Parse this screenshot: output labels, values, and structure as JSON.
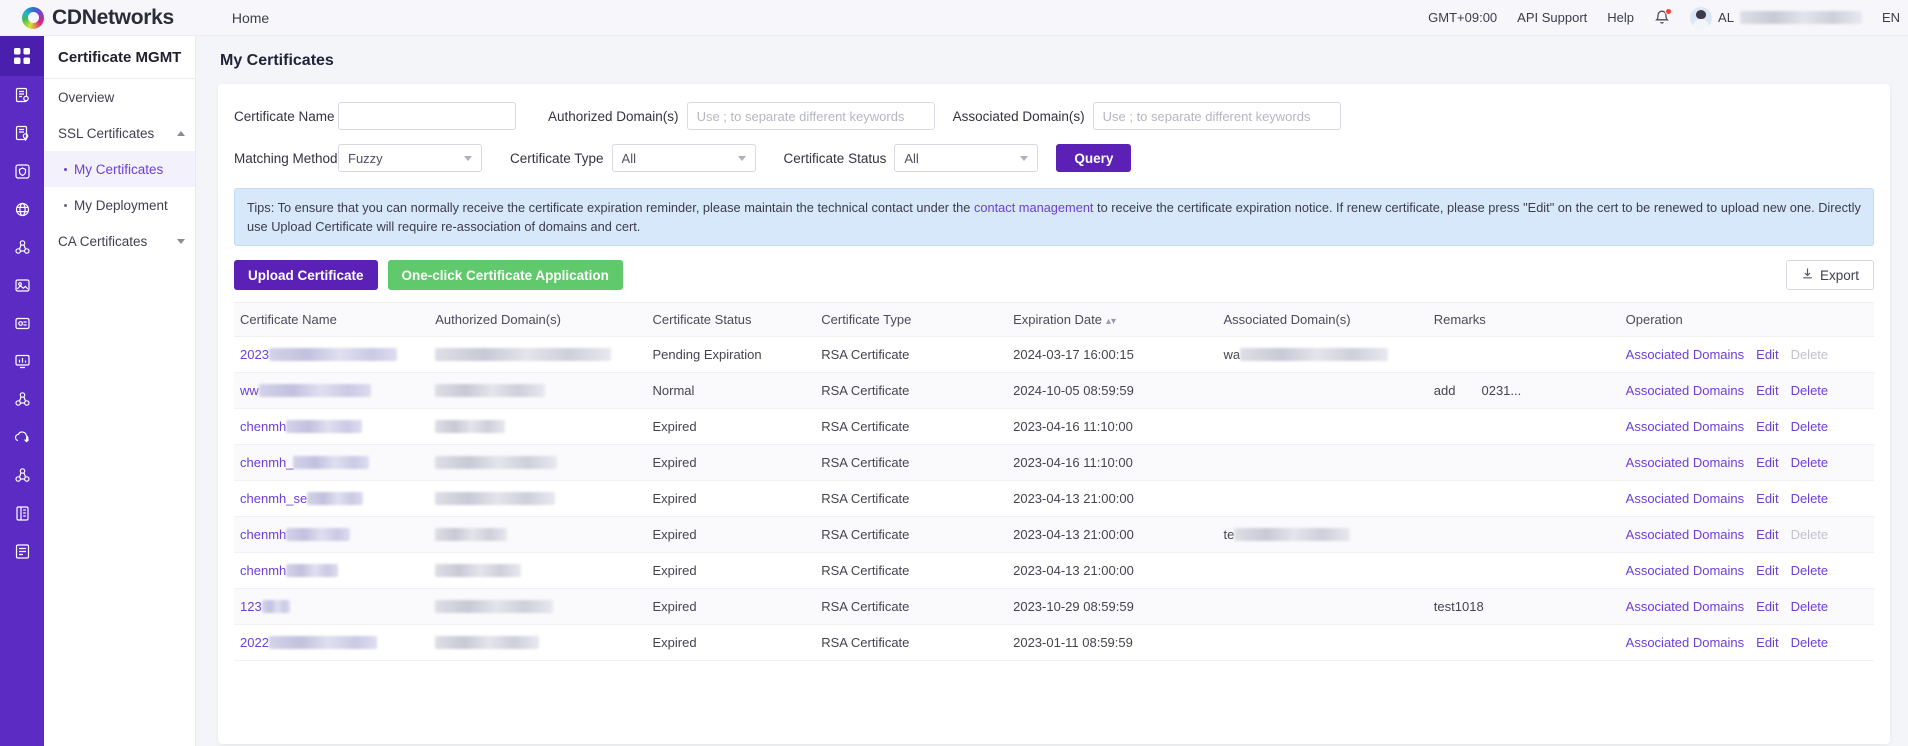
{
  "header": {
    "brand": "CDNetworks",
    "nav_home": "Home",
    "timezone": "GMT+09:00",
    "api_support": "API Support",
    "help": "Help",
    "user_prefix": "AL",
    "language": "EN",
    "bell_icon": "bell-icon",
    "avatar_icon": "avatar-icon"
  },
  "rail": {
    "items": [
      {
        "icon": "grid-apps-icon"
      },
      {
        "icon": "document-eye-icon"
      },
      {
        "icon": "certificate-icon"
      },
      {
        "icon": "shield-security-icon"
      },
      {
        "icon": "globe-cdn-icon"
      },
      {
        "icon": "nodes-network-icon"
      },
      {
        "icon": "image-media-icon"
      },
      {
        "icon": "media-card-icon"
      },
      {
        "icon": "monitor-chart-icon"
      },
      {
        "icon": "nodes-cluster-icon"
      },
      {
        "icon": "cloud-upload-icon"
      },
      {
        "icon": "nodes-cluster-2-icon"
      },
      {
        "icon": "server-rack-icon"
      },
      {
        "icon": "storage-db-icon"
      }
    ]
  },
  "sidebar": {
    "title": "Certificate MGMT",
    "items": [
      {
        "label": "Overview",
        "type": "link"
      },
      {
        "label": "SSL Certificates",
        "type": "group",
        "expanded": true,
        "caret": "chevron-up-icon"
      },
      {
        "label": "My Certificates",
        "type": "sub",
        "active": true
      },
      {
        "label": "My Deployment",
        "type": "sub",
        "active": false
      },
      {
        "label": "CA Certificates",
        "type": "group",
        "expanded": false,
        "caret": "chevron-down-icon"
      }
    ]
  },
  "page": {
    "title": "My Certificates"
  },
  "filters": {
    "certificate_name_label": "Certificate Name",
    "certificate_name_value": "",
    "certificate_name_placeholder": "",
    "authorized_domains_label": "Authorized Domain(s)",
    "authorized_domains_value": "",
    "authorized_domains_placeholder": "Use ; to separate different keywords",
    "associated_domains_label": "Associated Domain(s)",
    "associated_domains_value": "",
    "associated_domains_placeholder": "Use ; to separate different keywords",
    "matching_method_label": "Matching Method",
    "matching_method_value": "Fuzzy",
    "certificate_type_label": "Certificate Type",
    "certificate_type_value": "All",
    "certificate_status_label": "Certificate Status",
    "certificate_status_value": "All",
    "query_button": "Query"
  },
  "tips": {
    "part1": "Tips: To ensure that you can normally receive the certificate expiration reminder, please maintain the technical contact under the ",
    "link": "contact management",
    "part2": " to receive the certificate expiration notice. If renew certificate, please press \"Edit\" on the cert to be renewed to upload new one. Directly use Upload Certificate will require re-association of domains and cert."
  },
  "toolbar": {
    "upload_label": "Upload Certificate",
    "oneclick_label": "One-click Certificate Application",
    "export_label": "Export",
    "export_icon": "download-icon"
  },
  "table": {
    "columns": [
      "Certificate Name",
      "Authorized Domain(s)",
      "Certificate Status",
      "Certificate Type",
      "Expiration Date",
      "Associated Domain(s)",
      "Remarks",
      "Operation"
    ],
    "sort_column": "Expiration Date",
    "sort_icon": "sort-updown-icon",
    "operations": {
      "associated_domains": "Associated Domains",
      "edit": "Edit",
      "delete": "Delete"
    },
    "rows": [
      {
        "name_prefix": "2023",
        "name_redact_w": 128,
        "auth_redact_w": 176,
        "status": "Pending Expiration",
        "status_kind": "pending",
        "type": "RSA Certificate",
        "expiration": "2024-03-17 16:00:15",
        "assoc_prefix": "wa",
        "assoc_redact_w": 148,
        "remark": "",
        "remark_redact_w": 0,
        "delete_enabled": false
      },
      {
        "name_prefix": "ww",
        "name_redact_w": 112,
        "auth_redact_w": 110,
        "status": "Normal",
        "status_kind": "normal",
        "type": "RSA Certificate",
        "expiration": "2024-10-05 08:59:59",
        "assoc_prefix": "",
        "assoc_redact_w": 0,
        "remark": "add  0231...",
        "remark_redact_w": 0,
        "delete_enabled": true
      },
      {
        "name_prefix": "chenmh",
        "name_redact_w": 76,
        "auth_redact_w": 70,
        "status": "Expired",
        "status_kind": "expired",
        "type": "RSA Certificate",
        "expiration": "2023-04-16 11:10:00",
        "assoc_prefix": "",
        "assoc_redact_w": 0,
        "remark": "",
        "remark_redact_w": 0,
        "delete_enabled": true
      },
      {
        "name_prefix": "chenmh_",
        "name_redact_w": 76,
        "auth_redact_w": 122,
        "status": "Expired",
        "status_kind": "expired",
        "type": "RSA Certificate",
        "expiration": "2023-04-16 11:10:00",
        "assoc_prefix": "",
        "assoc_redact_w": 0,
        "remark": "",
        "remark_redact_w": 0,
        "delete_enabled": true
      },
      {
        "name_prefix": "chenmh_se",
        "name_redact_w": 56,
        "auth_redact_w": 120,
        "status": "Expired",
        "status_kind": "expired",
        "type": "RSA Certificate",
        "expiration": "2023-04-13 21:00:00",
        "assoc_prefix": "",
        "assoc_redact_w": 0,
        "remark": "",
        "remark_redact_w": 0,
        "delete_enabled": true
      },
      {
        "name_prefix": "chenmh",
        "name_redact_w": 64,
        "auth_redact_w": 72,
        "status": "Expired",
        "status_kind": "expired",
        "type": "RSA Certificate",
        "expiration": "2023-04-13 21:00:00",
        "assoc_prefix": "te",
        "assoc_redact_w": 116,
        "remark": "",
        "remark_redact_w": 0,
        "delete_enabled": false
      },
      {
        "name_prefix": "chenmh",
        "name_redact_w": 52,
        "auth_redact_w": 86,
        "status": "Expired",
        "status_kind": "expired",
        "type": "RSA Certificate",
        "expiration": "2023-04-13 21:00:00",
        "assoc_prefix": "",
        "assoc_redact_w": 0,
        "remark": "",
        "remark_redact_w": 0,
        "delete_enabled": true
      },
      {
        "name_prefix": "123",
        "name_redact_w": 28,
        "auth_redact_w": 118,
        "status": "Expired",
        "status_kind": "expired",
        "type": "RSA Certificate",
        "expiration": "2023-10-29 08:59:59",
        "assoc_prefix": "",
        "assoc_redact_w": 0,
        "remark": "test1018",
        "remark_redact_w": 0,
        "delete_enabled": true
      },
      {
        "name_prefix": "2022",
        "name_redact_w": 108,
        "auth_redact_w": 104,
        "status": "Expired",
        "status_kind": "expired",
        "type": "RSA Certificate",
        "expiration": "2023-01-11 08:59:59",
        "assoc_prefix": "",
        "assoc_redact_w": 0,
        "remark": "",
        "remark_redact_w": 0,
        "delete_enabled": true
      }
    ]
  },
  "colors": {
    "brand_purple": "#5b2bc4",
    "accent_purple": "#5b21b6",
    "link_purple": "#6d3fd6",
    "green": "#5fc96b",
    "status_pending": "#f07c22",
    "status_normal": "#48b35c",
    "status_expired": "#ef4b3c",
    "tips_bg": "#d7e8fb"
  }
}
